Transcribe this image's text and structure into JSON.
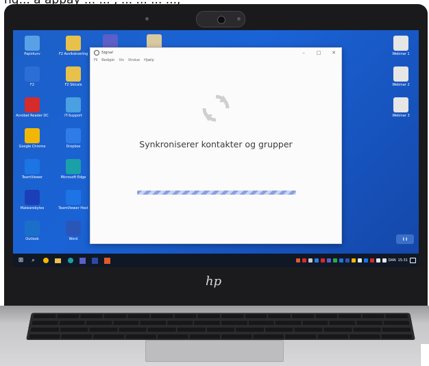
{
  "top_caption": "ng... a appay ... ... , ... ... ... ...,",
  "desktop": {
    "icons_left": [
      {
        "label": "Papirkurv",
        "icon": "recycle-bin-icon",
        "color": "#5aa0e6"
      },
      {
        "label": "F2",
        "icon": "f2-icon",
        "color": "#2b6fd6"
      },
      {
        "label": "Acrobat Reader DC",
        "icon": "acrobat-icon",
        "color": "#d62b2b"
      },
      {
        "label": "Google Chrome",
        "icon": "chrome-icon",
        "color": "#f2b705"
      },
      {
        "label": "TeamViewer",
        "icon": "teamviewer-icon",
        "color": "#1d74e4"
      },
      {
        "label": "Malwarebytes",
        "icon": "malwarebytes-icon",
        "color": "#1b3fb8"
      },
      {
        "label": "Outlook",
        "icon": "outlook-icon",
        "color": "#1c6fc8"
      }
    ],
    "icons_col2": [
      {
        "label": "F2 Avvikskvering",
        "icon": "folder-icon",
        "color": "#e8c14a"
      },
      {
        "label": "F2 Skicals",
        "icon": "folder-icon",
        "color": "#e8c14a"
      },
      {
        "label": "IT-Support",
        "icon": "support-icon",
        "color": "#4aa0e0"
      },
      {
        "label": "Dropbox",
        "icon": "dropbox-icon",
        "color": "#2f7be8"
      },
      {
        "label": "Microsoft Edge",
        "icon": "edge-icon",
        "color": "#1aa0a8"
      },
      {
        "label": "TeamViewer Host",
        "icon": "teamviewer-icon",
        "color": "#1d74e4"
      },
      {
        "label": "Word",
        "icon": "word-icon",
        "color": "#2a56b8"
      }
    ],
    "icons_col3": [
      {
        "label": "Teams",
        "icon": "teams-icon",
        "color": "#5b5fc7"
      },
      {
        "label": "",
        "icon": "document-icon",
        "color": "#d9c9a0"
      }
    ],
    "icons_right": [
      {
        "label": "Webinar 1",
        "icon": "file-icon",
        "color": "#e6e6e6"
      },
      {
        "label": "Webinar 2",
        "icon": "file-icon",
        "color": "#e6e6e6"
      },
      {
        "label": "Webinar 3",
        "icon": "file-icon",
        "color": "#e6e6e6"
      }
    ],
    "extra_label": "Kalkulen med",
    "right_bottom_label": "I I"
  },
  "window": {
    "title": "Signal",
    "menu": [
      "Fil",
      "Redigér",
      "Vis",
      "Vindue",
      "Hjælp"
    ],
    "controls": [
      "–",
      "□",
      "✕"
    ],
    "sync_message": "Synkroniserer kontakter og grupper"
  },
  "taskbar": {
    "tray_text": [
      "DAN",
      "15:31"
    ]
  },
  "brand_logo": "hp"
}
